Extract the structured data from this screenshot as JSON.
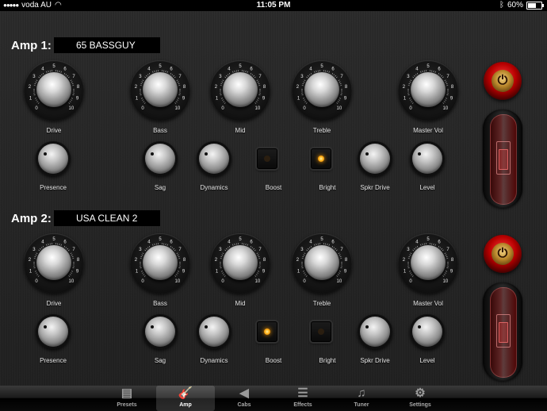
{
  "status_bar": {
    "carrier": "voda AU",
    "time": "11:05 PM",
    "battery": "60%",
    "battery_level": 0.6
  },
  "amps": [
    {
      "title": "Amp 1:",
      "preset": "65 BASSGUY",
      "power_on": true,
      "big_knobs": [
        {
          "label": "Drive",
          "scale": [
            "0",
            "1",
            "2",
            "3",
            "4",
            "5",
            "6",
            "7",
            "8",
            "9",
            "10"
          ]
        },
        {
          "label": "Bass",
          "scale": [
            "0",
            "1",
            "2",
            "3",
            "4",
            "5",
            "6",
            "7",
            "8",
            "9",
            "10"
          ]
        },
        {
          "label": "Mid",
          "scale": [
            "0",
            "1",
            "2",
            "3",
            "4",
            "5",
            "6",
            "7",
            "8",
            "9",
            "10"
          ]
        },
        {
          "label": "Treble",
          "scale": [
            "0",
            "1",
            "2",
            "3",
            "4",
            "5",
            "6",
            "7",
            "8",
            "9",
            "10"
          ]
        },
        {
          "label": "Master Vol",
          "scale": [
            "0",
            "1",
            "2",
            "3",
            "4",
            "5",
            "6",
            "7",
            "8",
            "9",
            "10"
          ]
        }
      ],
      "small_controls": [
        {
          "label": "Presence",
          "kind": "knob"
        },
        {
          "label": "Sag",
          "kind": "knob"
        },
        {
          "label": "Dynamics",
          "kind": "knob"
        },
        {
          "label": "Boost",
          "kind": "button",
          "on": false
        },
        {
          "label": "Bright",
          "kind": "button",
          "on": true
        },
        {
          "label": "Spkr Drive",
          "kind": "knob"
        },
        {
          "label": "Level",
          "kind": "knob"
        }
      ]
    },
    {
      "title": "Amp 2:",
      "preset": "USA CLEAN 2",
      "power_on": true,
      "big_knobs": [
        {
          "label": "Drive",
          "scale": [
            "0",
            "1",
            "2",
            "3",
            "4",
            "5",
            "6",
            "7",
            "8",
            "9",
            "10"
          ]
        },
        {
          "label": "Bass",
          "scale": [
            "0",
            "1",
            "2",
            "3",
            "4",
            "5",
            "6",
            "7",
            "8",
            "9",
            "10"
          ]
        },
        {
          "label": "Mid",
          "scale": [
            "0",
            "1",
            "2",
            "3",
            "4",
            "5",
            "6",
            "7",
            "8",
            "9",
            "10"
          ]
        },
        {
          "label": "Treble",
          "scale": [
            "0",
            "1",
            "2",
            "3",
            "4",
            "5",
            "6",
            "7",
            "8",
            "9",
            "10"
          ]
        },
        {
          "label": "Master Vol",
          "scale": [
            "0",
            "1",
            "2",
            "3",
            "4",
            "5",
            "6",
            "7",
            "8",
            "9",
            "10"
          ]
        }
      ],
      "small_controls": [
        {
          "label": "Presence",
          "kind": "knob"
        },
        {
          "label": "Sag",
          "kind": "knob"
        },
        {
          "label": "Dynamics",
          "kind": "knob"
        },
        {
          "label": "Boost",
          "kind": "button",
          "on": true
        },
        {
          "label": "Bright",
          "kind": "button",
          "on": false
        },
        {
          "label": "Spkr Drive",
          "kind": "knob"
        },
        {
          "label": "Level",
          "kind": "knob"
        }
      ]
    }
  ],
  "tabs": [
    {
      "label": "Presets",
      "icon": "presets-icon",
      "glyph": "▤",
      "active": false
    },
    {
      "label": "Amp",
      "icon": "guitar-icon",
      "glyph": "🎸",
      "active": true
    },
    {
      "label": "Cabs",
      "icon": "speaker-icon",
      "glyph": "◀",
      "active": false
    },
    {
      "label": "Effects",
      "icon": "sliders-icon",
      "glyph": "☰",
      "active": false
    },
    {
      "label": "Tuner",
      "icon": "music-note-icon",
      "glyph": "♫",
      "active": false
    },
    {
      "label": "Settings",
      "icon": "gear-icon",
      "glyph": "⚙",
      "active": false
    }
  ],
  "colors": {
    "accent_led": "#ffae17",
    "power_red": "#b60000",
    "active_tab_icon": "#4aa3ff"
  }
}
